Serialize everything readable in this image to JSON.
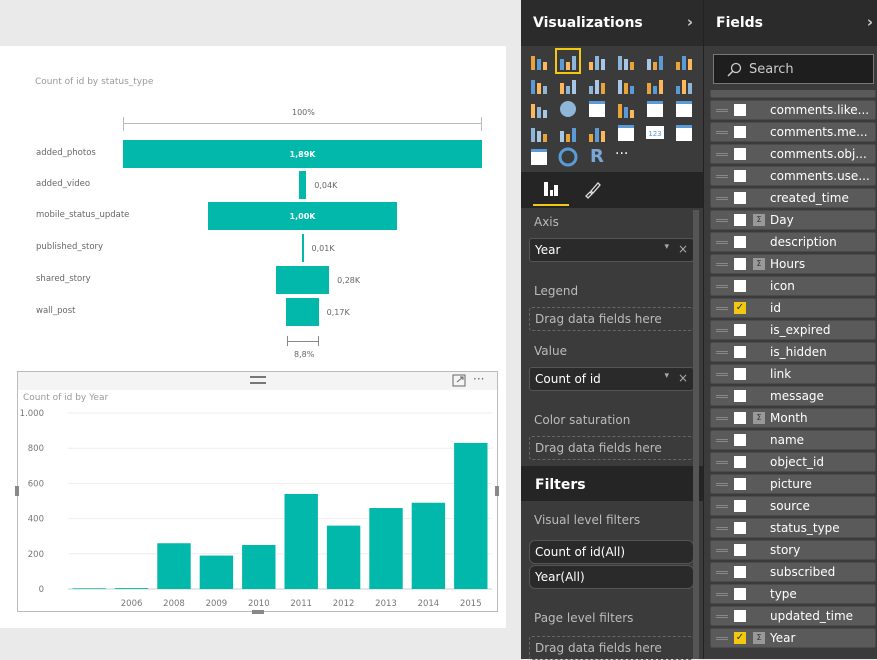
{
  "funnel": {
    "title": "Count of id by status_type",
    "top_label": "100%",
    "bottom_label": "8,8%",
    "chart_data": {
      "type": "funnel",
      "categories": [
        "added_photos",
        "added_video",
        "mobile_status_update",
        "published_story",
        "shared_story",
        "wall_post"
      ],
      "values": [
        1890,
        40,
        1000,
        10,
        280,
        170
      ],
      "labels": [
        "1,89K",
        "0,04K",
        "1,00K",
        "0,01K",
        "0,28K",
        "0,17K"
      ]
    }
  },
  "barchart": {
    "title": "Count of id by Year",
    "chart_data": {
      "type": "bar",
      "categories": [
        "",
        "2006",
        "2008",
        "2009",
        "2010",
        "2011",
        "2012",
        "2013",
        "2014",
        "2015"
      ],
      "values": [
        4,
        5,
        260,
        190,
        250,
        540,
        360,
        460,
        490,
        830
      ],
      "yticks": [
        "0",
        "200",
        "400",
        "600",
        "800",
        "1.000"
      ],
      "ylim": [
        0,
        1000
      ],
      "color": "#01b8aa",
      "grid": true
    }
  },
  "viz": {
    "title": "Visualizations",
    "chevron": "›",
    "icons": [
      "stacked-bar-icon",
      "stacked-column-icon",
      "clustered-bar-icon",
      "clustered-column-icon",
      "100-bar-icon",
      "100-column-icon",
      "line-chart-icon",
      "area-chart-icon",
      "stacked-area-icon",
      "line-column-icon",
      "line-clustered-column-icon",
      "ribbon-chart-icon",
      "scatter-icon",
      "pie-icon",
      "treemap-icon",
      "map-icon",
      "table-icon",
      "matrix-icon",
      "filled-map-icon",
      "funnel-icon",
      "gauge-icon",
      "multirow-card-icon",
      "card-icon",
      "kpi-icon",
      "slicer-icon",
      "donut-icon",
      "r-visual-icon",
      "more-icon"
    ],
    "more": "···",
    "r": "R",
    "card": "123",
    "wells": {
      "axis_label": "Axis",
      "axis_value": "Year",
      "legend_label": "Legend",
      "drop": "Drag data fields here",
      "value_label": "Value",
      "value_value": "Count of id",
      "color_label": "Color saturation"
    },
    "filters": {
      "title": "Filters",
      "visual_label": "Visual level filters",
      "visual": [
        "Count of id(All)",
        "Year(All)"
      ],
      "page_label": "Page level filters"
    }
  },
  "fields": {
    "title": "Fields",
    "chevron": "›",
    "search_placeholder": "Search",
    "items": [
      {
        "name": "comments.like...",
        "checked": false,
        "sigma": false
      },
      {
        "name": "comments.me...",
        "checked": false,
        "sigma": false
      },
      {
        "name": "comments.obj...",
        "checked": false,
        "sigma": false
      },
      {
        "name": "comments.use...",
        "checked": false,
        "sigma": false
      },
      {
        "name": "created_time",
        "checked": false,
        "sigma": false
      },
      {
        "name": "Day",
        "checked": false,
        "sigma": true
      },
      {
        "name": "description",
        "checked": false,
        "sigma": false
      },
      {
        "name": "Hours",
        "checked": false,
        "sigma": true
      },
      {
        "name": "icon",
        "checked": false,
        "sigma": false
      },
      {
        "name": "id",
        "checked": true,
        "sigma": false
      },
      {
        "name": "is_expired",
        "checked": false,
        "sigma": false
      },
      {
        "name": "is_hidden",
        "checked": false,
        "sigma": false
      },
      {
        "name": "link",
        "checked": false,
        "sigma": false
      },
      {
        "name": "message",
        "checked": false,
        "sigma": false
      },
      {
        "name": "Month",
        "checked": false,
        "sigma": true
      },
      {
        "name": "name",
        "checked": false,
        "sigma": false
      },
      {
        "name": "object_id",
        "checked": false,
        "sigma": false
      },
      {
        "name": "picture",
        "checked": false,
        "sigma": false
      },
      {
        "name": "source",
        "checked": false,
        "sigma": false
      },
      {
        "name": "status_type",
        "checked": false,
        "sigma": false
      },
      {
        "name": "story",
        "checked": false,
        "sigma": false
      },
      {
        "name": "subscribed",
        "checked": false,
        "sigma": false
      },
      {
        "name": "type",
        "checked": false,
        "sigma": false
      },
      {
        "name": "updated_time",
        "checked": false,
        "sigma": false
      },
      {
        "name": "Year",
        "checked": true,
        "sigma": true
      }
    ]
  },
  "colors": {
    "accent": "#01b8aa",
    "selected": "#f2c811"
  }
}
